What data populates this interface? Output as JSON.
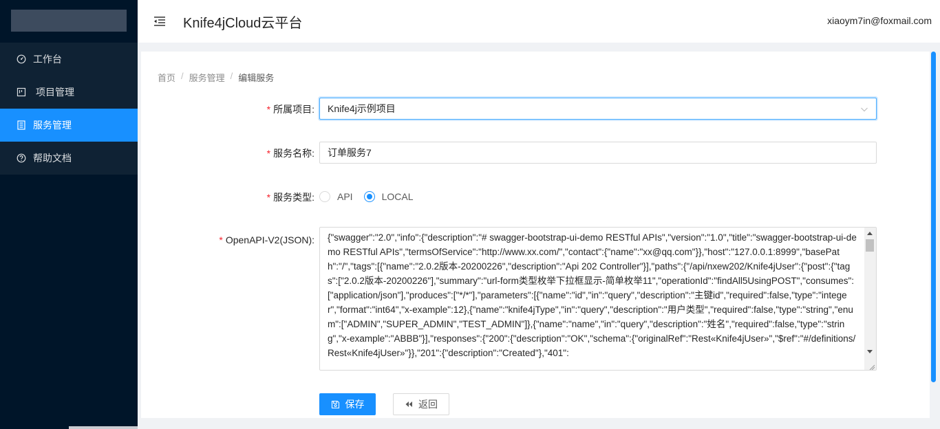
{
  "header": {
    "title": "Knife4jCloud云平台",
    "user_email": "xiaoym7in@foxmail.com"
  },
  "sidebar": {
    "items": [
      {
        "label": "工作台",
        "icon": "dashboard-icon",
        "active": false
      },
      {
        "label": "项目管理",
        "icon": "project-icon",
        "active": false
      },
      {
        "label": "服务管理",
        "icon": "service-icon",
        "active": true
      },
      {
        "label": "帮助文档",
        "icon": "help-icon",
        "active": false
      }
    ]
  },
  "breadcrumb": {
    "items": [
      "首页",
      "服务管理",
      "编辑服务"
    ],
    "separator": "/"
  },
  "form": {
    "project": {
      "label": "所属项目",
      "value": "Knife4j示例项目"
    },
    "service_name": {
      "label": "服务名称",
      "value": "订单服务7"
    },
    "service_type": {
      "label": "服务类型",
      "options": [
        "API",
        "LOCAL"
      ],
      "selected": "LOCAL"
    },
    "openapi": {
      "label": "OpenAPI-V2(JSON)",
      "value": "{\"swagger\":\"2.0\",\"info\":{\"description\":\"# swagger-bootstrap-ui-demo RESTful APIs\",\"version\":\"1.0\",\"title\":\"swagger-bootstrap-ui-demo RESTful APIs\",\"termsOfService\":\"http://www.xx.com/\",\"contact\":{\"name\":\"xx@qq.com\"}},\"host\":\"127.0.0.1:8999\",\"basePath\":\"/\",\"tags\":[{\"name\":\"2.0.2版本-20200226\",\"description\":\"Api 202 Controller\"}],\"paths\":{\"/api/nxew202/Knife4jUser\":{\"post\":{\"tags\":[\"2.0.2版本-20200226\"],\"summary\":\"url-form类型枚举下拉框显示-简单枚举11\",\"operationId\":\"findAll5UsingPOST\",\"consumes\":[\"application/json\"],\"produces\":[\"*/*\"],\"parameters\":[{\"name\":\"id\",\"in\":\"query\",\"description\":\"主键id\",\"required\":false,\"type\":\"integer\",\"format\":\"int64\",\"x-example\":12},{\"name\":\"knife4jType\",\"in\":\"query\",\"description\":\"用户类型\",\"required\":false,\"type\":\"string\",\"enum\":[\"ADMIN\",\"SUPER_ADMIN\",\"TEST_ADMIN\"]},{\"name\":\"name\",\"in\":\"query\",\"description\":\"姓名\",\"required\":false,\"type\":\"string\",\"x-example\":\"ABBB\"}],\"responses\":{\"200\":{\"description\":\"OK\",\"schema\":{\"originalRef\":\"Rest«Knife4jUser»\",\"$ref\":\"#/definitions/Rest«Knife4jUser»\"}},\"201\":{\"description\":\"Created\"},\"401\":"
    }
  },
  "buttons": {
    "save": "保存",
    "back": "返回"
  },
  "colors": {
    "primary": "#1890ff",
    "sidebar_bg": "#001529",
    "required": "#f5222d"
  }
}
